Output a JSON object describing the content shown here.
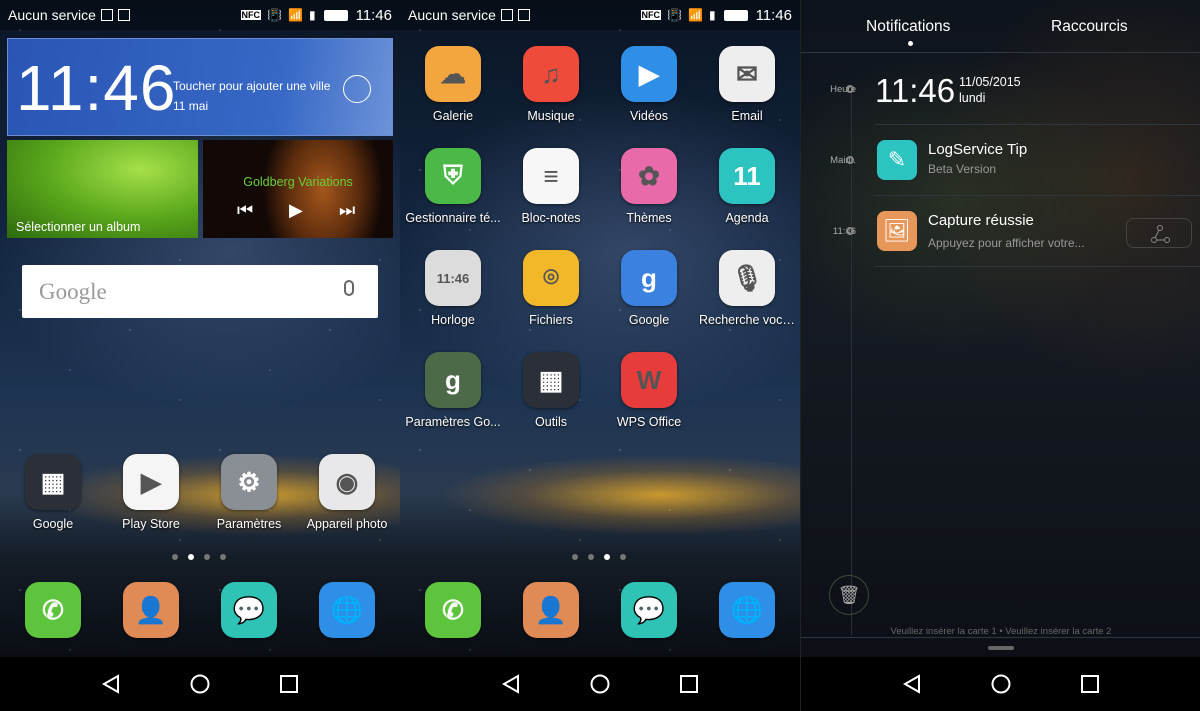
{
  "status": {
    "carrier": "Aucun service",
    "time": "11:46",
    "icons": [
      "edit-icon",
      "screenshot-icon",
      "nfc-icon",
      "vibrate-icon",
      "wifi-icon",
      "sim-icon",
      "battery-icon"
    ],
    "nfc": "NFC"
  },
  "home": {
    "weather": {
      "time": "11:46",
      "city_prompt": "Toucher pour ajouter une ville",
      "date": "11 mai",
      "icon": "sun-icon"
    },
    "album": {
      "label": "Sélectionner un album"
    },
    "music": {
      "title": "Goldberg Variations",
      "title_color": "#6ad03a"
    },
    "search": {
      "logo": "Google"
    },
    "apps": [
      {
        "label": "Google",
        "color": "#2a2f38",
        "glyph": "▦"
      },
      {
        "label": "Play Store",
        "color": "#f5f5f5",
        "glyph": "▶"
      },
      {
        "label": "Paramètres",
        "color": "#8a8f96",
        "glyph": "⚙"
      },
      {
        "label": "Appareil photo",
        "color": "#e8e8ea",
        "glyph": "◉"
      }
    ],
    "page_dots": 4,
    "active_page": 2
  },
  "drawer": {
    "apps": [
      {
        "label": "Galerie",
        "color": "#f3a640",
        "glyph": "☁"
      },
      {
        "label": "Musique",
        "color": "#ef4b3a",
        "glyph": "♫"
      },
      {
        "label": "Vidéos",
        "color": "#2f8ee6",
        "glyph": "▶"
      },
      {
        "label": "Email",
        "color": "#eeeeee",
        "glyph": "✉"
      },
      {
        "label": "Gestionnaire té...",
        "color": "#4cb848",
        "glyph": "⛨"
      },
      {
        "label": "Bloc-notes",
        "color": "#f7f7f7",
        "glyph": "≡"
      },
      {
        "label": "Thèmes",
        "color": "#e86aa8",
        "glyph": "✿"
      },
      {
        "label": "Agenda",
        "color": "#2cc3c0",
        "glyph": "11"
      },
      {
        "label": "Horloge",
        "color": "#dcdcdc",
        "glyph": "11:46"
      },
      {
        "label": "Fichiers",
        "color": "#f3b82a",
        "glyph": "⌾"
      },
      {
        "label": "Google",
        "color": "#3b82e0",
        "glyph": "g"
      },
      {
        "label": "Recherche voca...",
        "color": "#eeeeee",
        "glyph": "🎙"
      },
      {
        "label": "Paramètres Go...",
        "color": "#4d6a48",
        "glyph": "g"
      },
      {
        "label": "Outils",
        "color": "#2a2f38",
        "glyph": "▦"
      },
      {
        "label": "WPS Office",
        "color": "#e83c3c",
        "glyph": "W"
      }
    ],
    "page_dots": 4,
    "active_page": 3
  },
  "dock": [
    {
      "name": "phone",
      "color": "#5ec43e",
      "glyph": "✆"
    },
    {
      "name": "contacts",
      "color": "#e08a55",
      "glyph": "👤"
    },
    {
      "name": "messages",
      "color": "#2fc3b5",
      "glyph": "💬"
    },
    {
      "name": "browser",
      "color": "#2f8ee6",
      "glyph": "🌐"
    }
  ],
  "notifications": {
    "tabs": [
      "Notifications",
      "Raccourcis"
    ],
    "timeline": [
      "Heure",
      "Maint.",
      "11:46"
    ],
    "clock": {
      "time": "11:46",
      "date": "11/05/2015",
      "day": "lundi"
    },
    "items": [
      {
        "title": "LogService Tip",
        "subtitle": "Beta Version",
        "color": "#2cc3c0"
      },
      {
        "title": "Capture réussie",
        "subtitle": "Appuyez pour afficher votre...",
        "color": "#e8975a"
      }
    ],
    "sim_status": "Veuillez insérer la carte 1 • Veuillez insérer la carte 2"
  }
}
